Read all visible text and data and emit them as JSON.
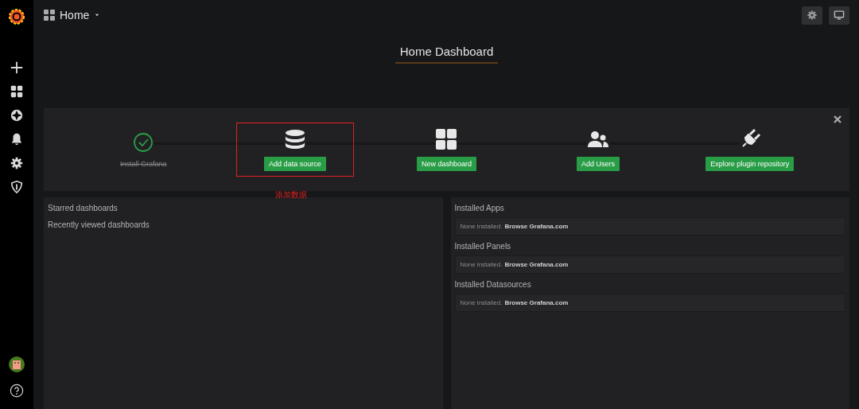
{
  "topbar": {
    "title": "Home"
  },
  "dashboard_title": "Home Dashboard",
  "steps": [
    {
      "label": "Install Grafana",
      "kind": "check",
      "done": true,
      "highlighted": false
    },
    {
      "label": "Add data source",
      "kind": "database",
      "done": false,
      "highlighted": true
    },
    {
      "label": "New dashboard",
      "kind": "grid",
      "done": false,
      "highlighted": false
    },
    {
      "label": "Add Users",
      "kind": "users",
      "done": false,
      "highlighted": false
    },
    {
      "label": "Explore plugin repository",
      "kind": "plug",
      "done": false,
      "highlighted": false
    }
  ],
  "annotation": {
    "text": "添加数据"
  },
  "dashboard_lists": [
    "Starred dashboards",
    "Recently viewed dashboards"
  ],
  "plugin_sections": [
    {
      "title": "Installed Apps",
      "empty_text": "None installed.",
      "link": "Browse Grafana.com"
    },
    {
      "title": "Installed Panels",
      "empty_text": "None installed.",
      "link": "Browse Grafana.com"
    },
    {
      "title": "Installed Datasources",
      "empty_text": "None installed.",
      "link": "Browse Grafana.com"
    }
  ]
}
